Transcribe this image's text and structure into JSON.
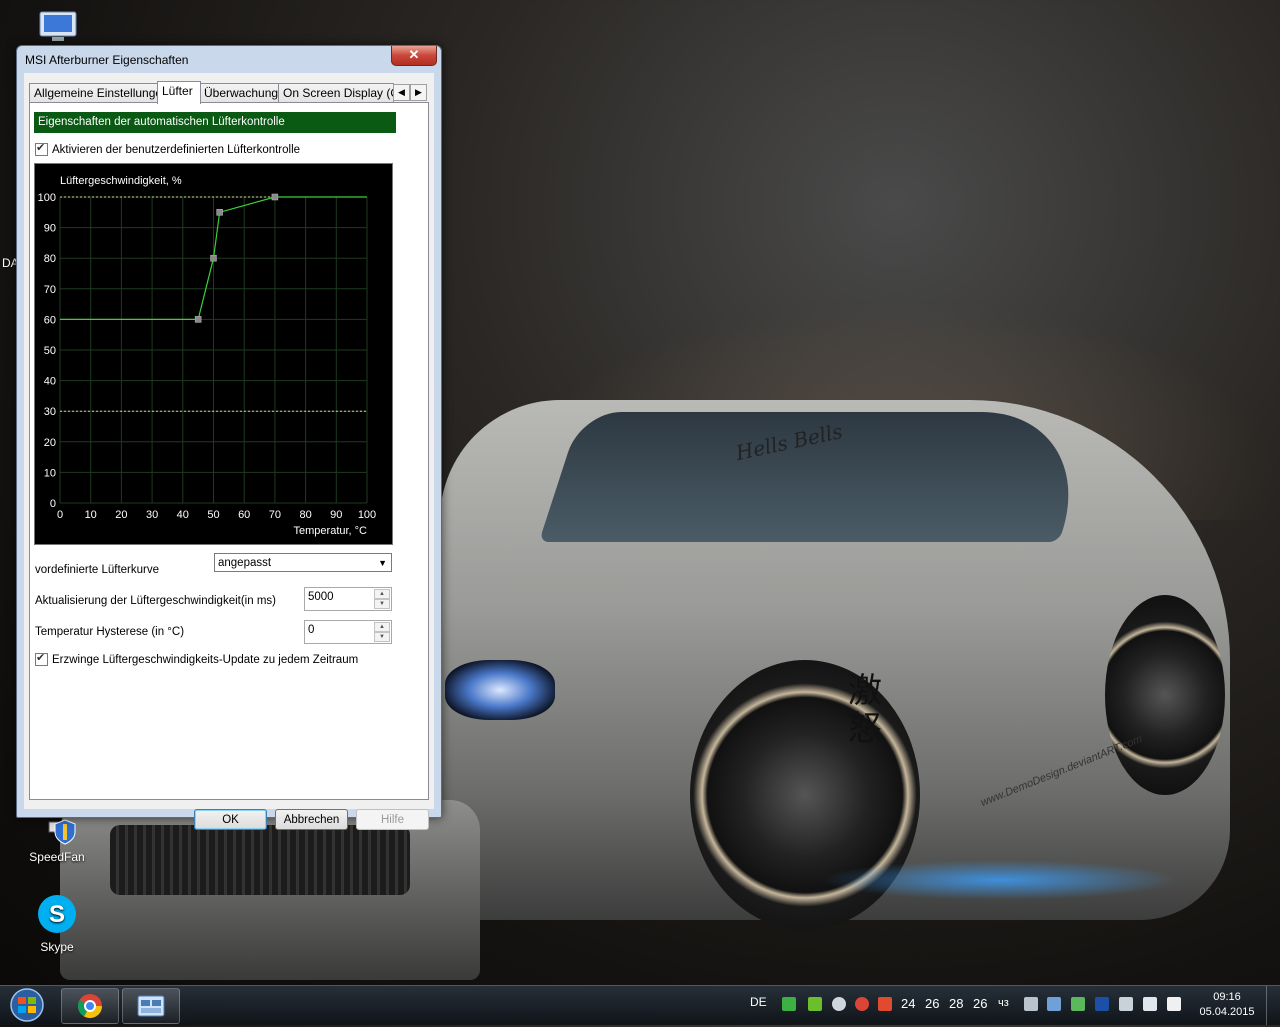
{
  "window": {
    "title": "MSI Afterburner Eigenschaften",
    "close_glyph": "✕"
  },
  "tabs": [
    {
      "label": "Allgemeine Einstellungen",
      "active": false
    },
    {
      "label": "Lüfter",
      "active": true
    },
    {
      "label": "Überwachung",
      "active": false
    },
    {
      "label": "On Screen Display (OS",
      "active": false
    }
  ],
  "tab_scroll": {
    "left": "◀",
    "right": "▶"
  },
  "fan": {
    "section_title": "Eigenschaften der automatischen Lüfterkontrolle",
    "enable_custom_label": "Aktivieren der benutzerdefinierten Lüfterkontrolle",
    "enable_custom_checked": true,
    "preset_curve_label": "vordefinierte Lüfterkurve",
    "preset_curve_value": "angepasst",
    "update_interval_label": "Aktualisierung der Lüftergeschwindigkeit(in ms)",
    "update_interval_value": "5000",
    "hysteresis_label": "Temperatur Hysterese (in °C)",
    "hysteresis_value": "0",
    "force_update_label": "Erzwinge Lüftergeschwindigkeits-Update zu jedem Zeitraum",
    "force_update_checked": true
  },
  "chart_data": {
    "type": "line",
    "ylabel": "Lüftergeschwindigkeit, %",
    "xlabel": "Temperatur, °C",
    "xlim": [
      0,
      100
    ],
    "ylim": [
      0,
      100
    ],
    "x_ticks": [
      "0",
      "10",
      "20",
      "30",
      "40",
      "50",
      "60",
      "70",
      "80",
      "90",
      "100"
    ],
    "y_ticks": [
      "0",
      "10",
      "20",
      "30",
      "40",
      "50",
      "60",
      "70",
      "80",
      "90",
      "100"
    ],
    "grid": true,
    "reference_lines_y": [
      30,
      100
    ],
    "colors": {
      "line": "#39d039",
      "point": "#8a8a8a",
      "grid": "#1f3a1f",
      "ref": "#d8d88a",
      "text": "#ffffff"
    },
    "x": [
      0,
      45,
      50,
      52,
      70,
      100
    ],
    "y": [
      60,
      60,
      80,
      95,
      100,
      100
    ],
    "control_points_x": [
      45,
      50,
      52,
      70
    ],
    "control_points_y": [
      60,
      80,
      95,
      100
    ]
  },
  "buttons": {
    "ok": "OK",
    "cancel": "Abbrechen",
    "help": "Hilfe"
  },
  "desktop_icons": [
    {
      "label": "SpeedFan"
    },
    {
      "label": "Skype"
    }
  ],
  "desktop_edge_text": "DA",
  "wallpaper": {
    "signature": "Hells Bells",
    "credit": "www.DemoDesign.deviantART.com",
    "kanji": "激怒"
  },
  "taskbar": {
    "language": "DE",
    "temps": [
      "24",
      "26",
      "28",
      "26"
    ],
    "tray_label": "чз",
    "time": "09:16",
    "date": "05.04.2015"
  }
}
